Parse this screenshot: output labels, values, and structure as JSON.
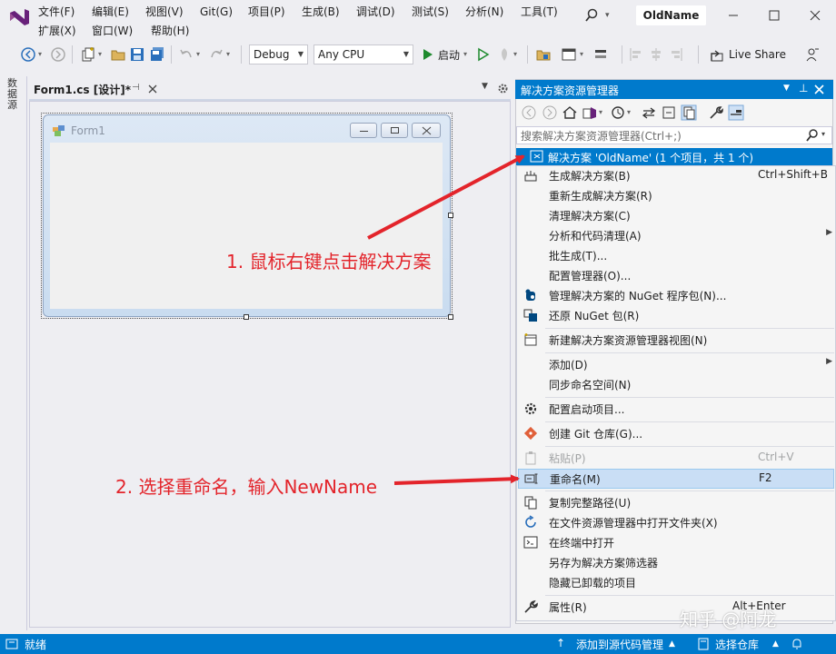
{
  "menu": {
    "row1": [
      "文件(F)",
      "编辑(E)",
      "视图(V)",
      "Git(G)",
      "项目(P)",
      "生成(B)",
      "调试(D)",
      "测试(S)",
      "分析(N)",
      "工具(T)"
    ],
    "row2": [
      "扩展(X)",
      "窗口(W)",
      "帮助(H)"
    ]
  },
  "solution_name": "OldName",
  "toolbar": {
    "config": "Debug",
    "platform": "Any CPU",
    "start_label": "启动",
    "live_share": "Live Share"
  },
  "left_strip_label": "数据源",
  "document": {
    "tab_title": "Form1.cs [设计]*",
    "form_title": "Form1"
  },
  "solution_explorer": {
    "title": "解决方案资源管理器",
    "search_placeholder": "搜索解决方案资源管理器(Ctrl+;)",
    "selected_node": "解决方案 'OldName' (1 个项目，共 1 个)"
  },
  "context_menu": {
    "build": {
      "label": "生成解决方案(B)",
      "shortcut": "Ctrl+Shift+B"
    },
    "rebuild": {
      "label": "重新生成解决方案(R)"
    },
    "clean": {
      "label": "清理解决方案(C)"
    },
    "analyze": {
      "label": "分析和代码清理(A)"
    },
    "batch": {
      "label": "批生成(T)..."
    },
    "config_mgr": {
      "label": "配置管理器(O)..."
    },
    "nuget_manage": {
      "label": "管理解决方案的 NuGet 程序包(N)..."
    },
    "nuget_restore": {
      "label": "还原 NuGet 包(R)"
    },
    "new_view": {
      "label": "新建解决方案资源管理器视图(N)"
    },
    "add": {
      "label": "添加(D)"
    },
    "sync_ns": {
      "label": "同步命名空间(N)"
    },
    "startup": {
      "label": "配置启动项目..."
    },
    "git_repo": {
      "label": "创建 Git 仓库(G)..."
    },
    "paste": {
      "label": "粘贴(P)",
      "shortcut": "Ctrl+V"
    },
    "rename": {
      "label": "重命名(M)",
      "shortcut": "F2"
    },
    "copy_path": {
      "label": "复制完整路径(U)"
    },
    "open_folder": {
      "label": "在文件资源管理器中打开文件夹(X)"
    },
    "open_terminal": {
      "label": "在终端中打开"
    },
    "save_filter": {
      "label": "另存为解决方案筛选器"
    },
    "hide_unloaded": {
      "label": "隐藏已卸载的项目"
    },
    "properties": {
      "label": "属性(R)",
      "shortcut": "Alt+Enter"
    }
  },
  "annotations": {
    "step1": "1. 鼠标右键点击解决方案",
    "step2": "2. 选择重命名，输入NewName",
    "color": "#e3242b"
  },
  "watermark": "知乎 @阿龙",
  "status_bar": {
    "state": "就绪",
    "source_control": "添加到源代码管理",
    "repo": "选择仓库"
  },
  "colors": {
    "accent": "#007acc",
    "vs_purple": "#68217a",
    "menu_highlight": "#c9def5"
  }
}
